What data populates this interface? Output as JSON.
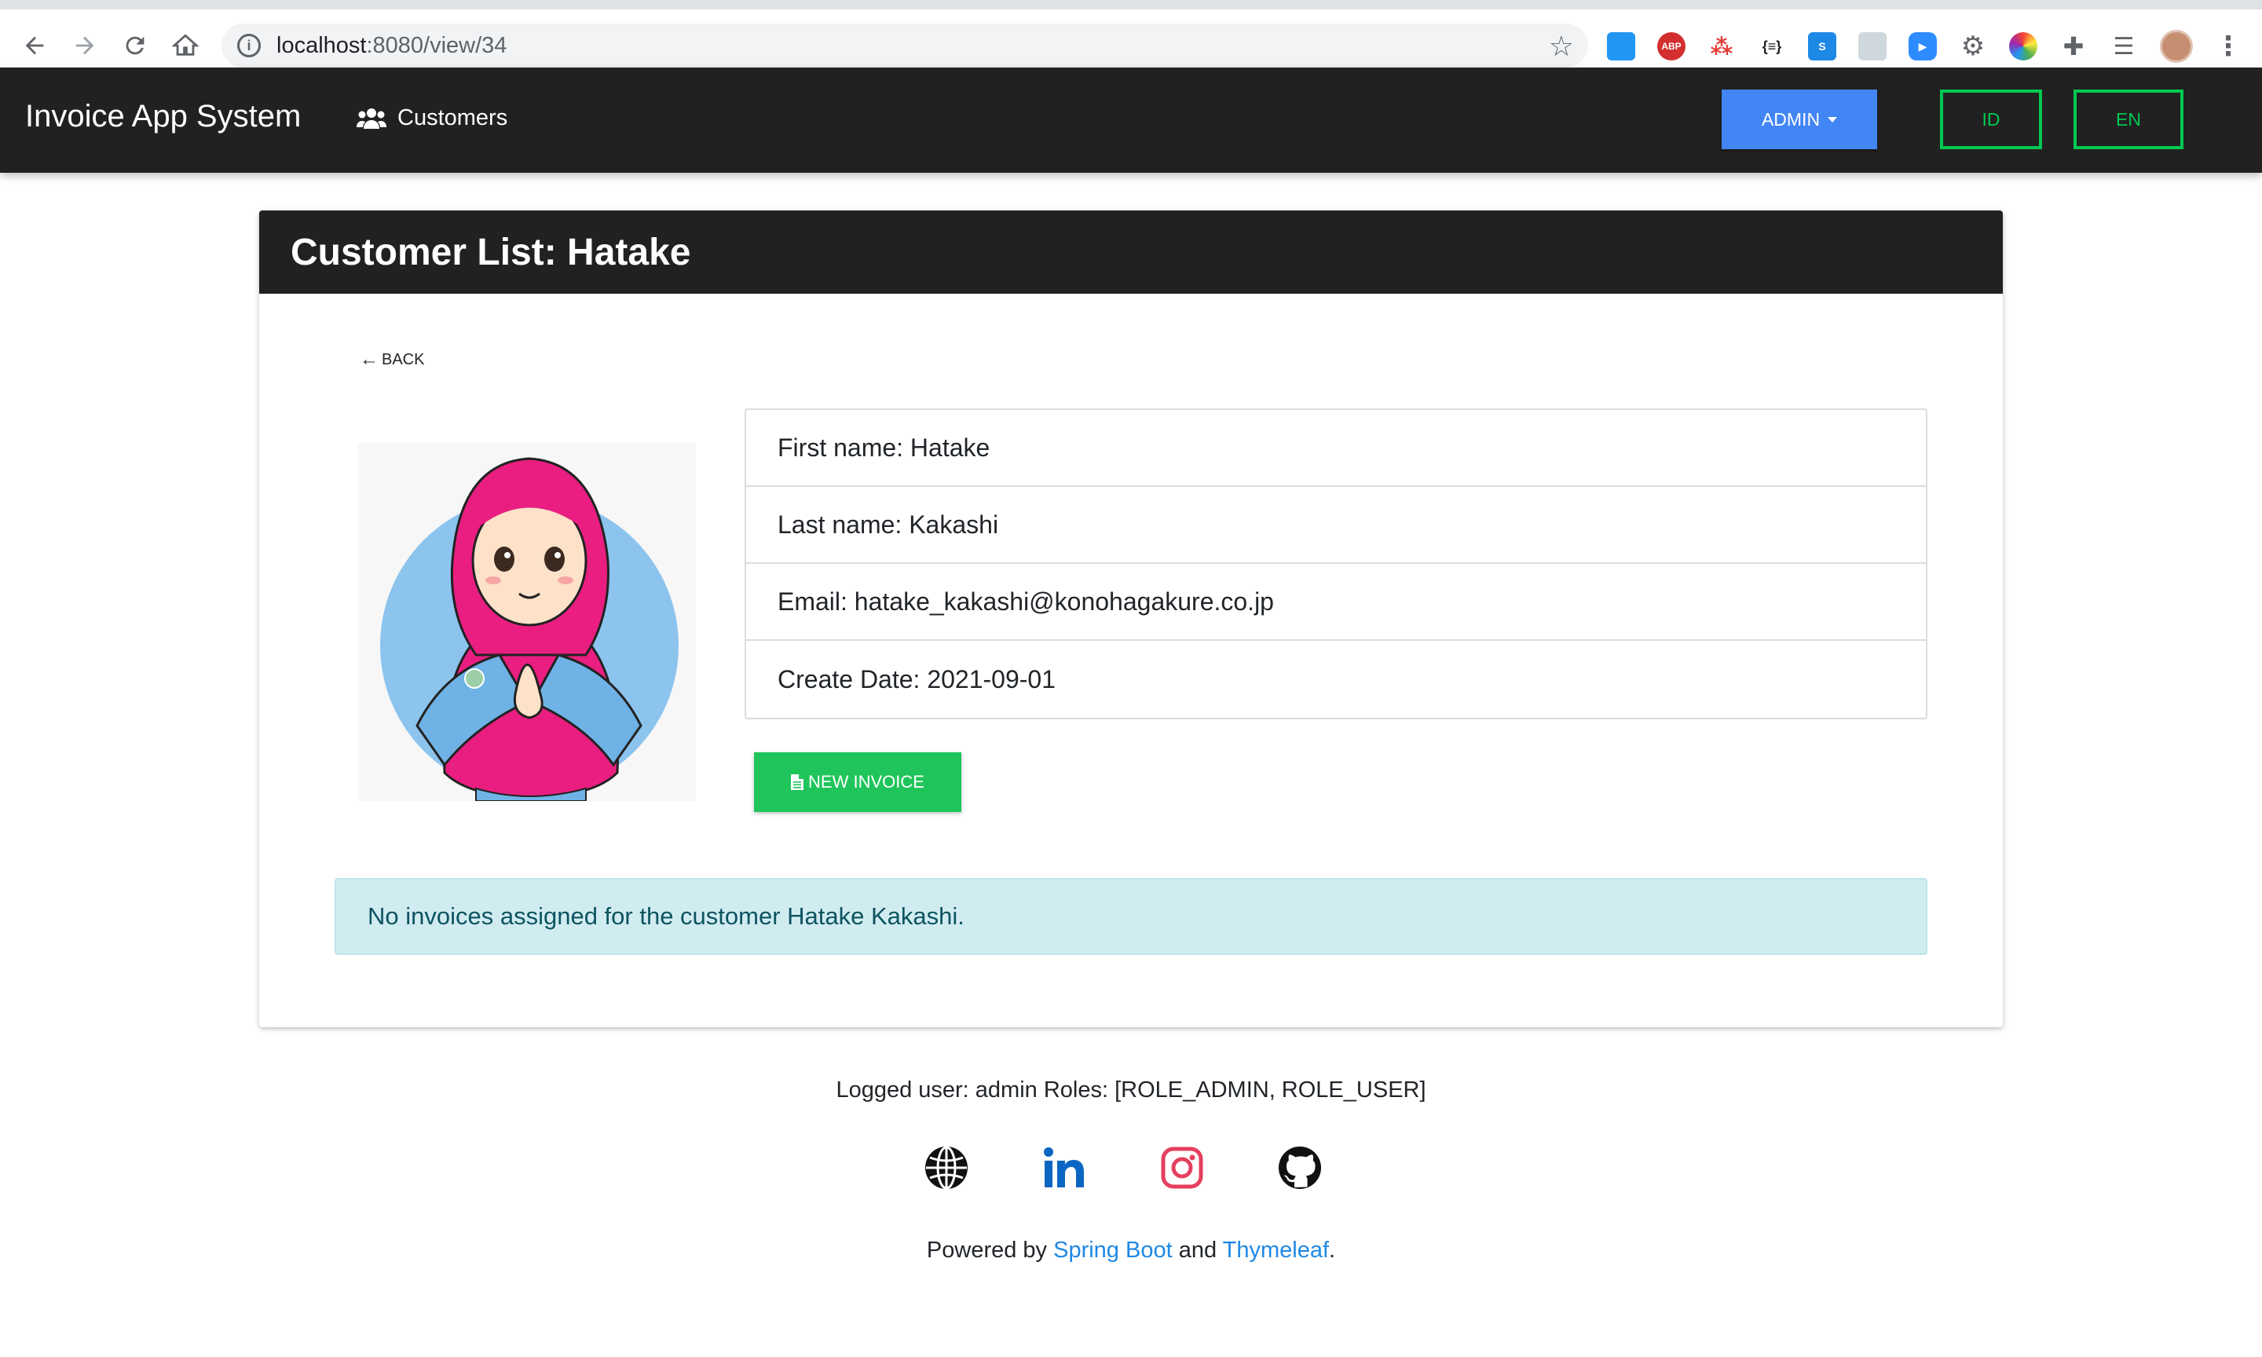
{
  "browser": {
    "url_host": "localhost",
    "url_rest": ":8080/view/34",
    "extensions": [
      {
        "name": "window-resizer-icon"
      },
      {
        "name": "adblock-plus-icon",
        "label": "ABP"
      },
      {
        "name": "network-icon"
      },
      {
        "name": "json-viewer-icon",
        "label": "{≡}"
      },
      {
        "name": "s-extension-icon",
        "label": "S"
      },
      {
        "name": "bookmark-extension-icon"
      },
      {
        "name": "zoom-icon"
      },
      {
        "name": "gear-extension-icon"
      },
      {
        "name": "color-picker-icon"
      },
      {
        "name": "puzzle-icon"
      },
      {
        "name": "reading-list-icon"
      }
    ]
  },
  "navbar": {
    "brand": "Invoice App System",
    "customers_link": "Customers",
    "admin_label": "ADMIN",
    "lang_id": "ID",
    "lang_en": "EN",
    "colors": {
      "bar": "#212121",
      "admin": "#4285f4",
      "lang": "#00c851"
    }
  },
  "card": {
    "title": "Customer List: Hatake",
    "back_label": "BACK",
    "details": {
      "first_name": "First name: Hatake",
      "last_name": "Last name: Kakashi",
      "email": "Email: hatake_kakashi@konohagakure.co.jp",
      "create_date": "Create Date: 2021-09-01"
    },
    "new_invoice_label": "NEW INVOICE",
    "alert": "No invoices assigned for the customer Hatake Kakashi."
  },
  "footer": {
    "logged_user": "Logged user: admin Roles: [ROLE_ADMIN, ROLE_USER]",
    "powered_prefix": "Powered by ",
    "spring_boot": "Spring Boot",
    "and": " and ",
    "thymeleaf": "Thymeleaf",
    "period": ".",
    "social": [
      "globe-icon",
      "linkedin-icon",
      "instagram-icon",
      "github-icon"
    ]
  }
}
